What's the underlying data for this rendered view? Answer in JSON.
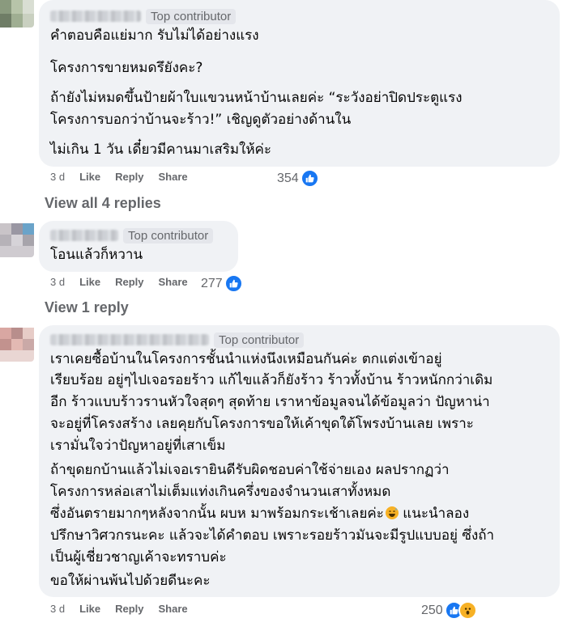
{
  "comments": [
    {
      "badge": "Top contributor",
      "lines": [
        "คำตอบคือแย่มาก รับไม่ได้อย่างแรง",
        "โครงการขายหมดรึยังคะ?",
        "ถ้ายังไม่หมดขึ้นป้ายผ้าใบแขวนหน้าบ้านเลยค่ะ “ระวังอย่าปิดประตูแรง",
        "โครงการบอกว่าบ้านจะร้าว!” เชิญดูตัวอย่างด้านใน",
        "ไม่เกิน 1 วัน เดี๋ยวมีคานมาเสริมให้ค่ะ"
      ],
      "time": "3 d",
      "like": "Like",
      "reply": "Reply",
      "share": "Share",
      "reaction_count": "354",
      "reactions": [
        "like-icon"
      ],
      "view_replies": "View all 4 replies"
    },
    {
      "badge": "Top contributor",
      "lines": [
        "โอนแล้วก็หวาน"
      ],
      "time": "3 d",
      "like": "Like",
      "reply": "Reply",
      "share": "Share",
      "reaction_count": "277",
      "reactions": [
        "like-icon"
      ],
      "view_replies": "View 1 reply"
    },
    {
      "badge": "Top contributor",
      "lines": [
        "เราเคยซื้อบ้านในโครงการชั้นนำแห่งนึงเหมือนกันค่ะ ตกแต่งเข้าอยู่",
        "เรียบร้อย อยู่ๆไปเจอรอยร้าว แก้ไขแล้วก็ยังร้าว ร้าวทั้งบ้าน ร้าวหนักกว่าเดิม",
        "อีก ร้าวแบบร้าวรานหัวใจสุดๆ สุดท้าย เราหาข้อมูลจนได้ข้อมูลว่า ปัญหาน่า",
        "จะอยู่ที่โครงสร้าง เลยคุยกับโครงการขอให้เค้าขุดใต้โพรงบ้านเลย เพราะ",
        "เรามั่นใจว่าปัญหาอยู่ที่เสาเข็ม",
        "ถ้าขุดยกบ้านแล้วไม่เจอเรายินดีรับผิดชอบค่าใช้จ่ายเอง ผลปรากฏว่า",
        "โครงการหล่อเสาไม่เต็มแท่งเกินครึ่งของจำนวนเสาทั้งหมด",
        "ซึ่งอันตรายมากๆหลังจากนั้น ผบห มาพร้อมกระเช้าเลยค่ะ",
        "ปรึกษาวิศวกรนะคะ แล้วจะได้คำตอบ เพราะรอยร้าวมันจะมีรูปแบบอยู่ ซึ่งถ้า",
        "เป็นผู้เชี่ยวชาญเค้าจะทราบค่ะ",
        "ขอให้ผ่านพ้นไปด้วยดีนะคะ"
      ],
      "line8_suffix": " แนะนำลอง",
      "time": "3 d",
      "like": "Like",
      "reply": "Reply",
      "share": "Share",
      "reaction_count": "250",
      "reactions": [
        "like-icon",
        "wow-icon"
      ],
      "emoji": "grinning-sweat-emoji"
    }
  ],
  "colors": {
    "bubble": "#f0f2f5",
    "secondary_text": "#65676b",
    "like_blue": "#1877f2",
    "wow_yellow": "#f7b125"
  }
}
